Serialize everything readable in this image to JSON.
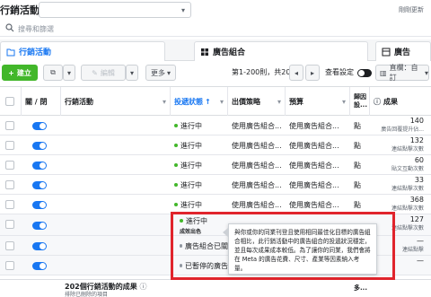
{
  "header": {
    "title": "行銷活動",
    "account_value": "",
    "updated_label": "剛剛更新"
  },
  "search": {
    "placeholder": "搜尋和篩選"
  },
  "tabs": [
    {
      "label": "行銷活動"
    },
    {
      "label": "廣告組合"
    },
    {
      "label": "廣告"
    }
  ],
  "toolbar": {
    "create_label": "建立",
    "edit_label": "編輯",
    "more_label": "更多",
    "range_label": "第1-200則，共202則",
    "view_setting_label": "查看設定",
    "columns_label": "直欄：自訂"
  },
  "table": {
    "headers": {
      "onoff": "關 / 閉",
      "campaign": "行銷活動",
      "delivery": "投遞狀態",
      "bid": "出價策略",
      "budget": "預算",
      "attribution": "歸因設...",
      "results": "成果"
    },
    "rows": [
      {
        "delivery": "進行中",
        "bid": "使用廣告組合...",
        "budget": "使用廣告組合...",
        "attribution": "點",
        "result": "140",
        "result_unit": "廣告回覆提升佔..."
      },
      {
        "delivery": "進行中",
        "bid": "使用廣告組合...",
        "budget": "使用廣告組合...",
        "attribution": "點",
        "result": "132",
        "result_unit": "連結點擊次數"
      },
      {
        "delivery": "進行中",
        "bid": "使用廣告組合...",
        "budget": "使用廣告組合...",
        "attribution": "點",
        "result": "60",
        "result_unit": "貼文互動次數"
      },
      {
        "delivery": "進行中",
        "bid": "使用廣告組合...",
        "budget": "使用廣告組合...",
        "attribution": "點",
        "result": "33",
        "result_unit": "連結點擊次數"
      },
      {
        "delivery": "進行中",
        "bid": "使用廣告組合...",
        "budget": "使用廣告組合...",
        "attribution": "點",
        "result": "368",
        "result_unit": "連結點擊次數"
      },
      {
        "delivery": "進行中",
        "delivery_sub": "成效出色",
        "bid": "",
        "budget": "",
        "attribution": "",
        "result": "127",
        "result_unit": "連結點擊次數"
      },
      {
        "delivery": "廣告組合已關",
        "bid": "",
        "budget": "",
        "attribution": "",
        "result": "—",
        "result_unit": "連結點擊"
      },
      {
        "delivery": "已暫停的廣告",
        "bid": "",
        "budget": "",
        "attribution": "",
        "result": "—",
        "result_unit": ""
      }
    ]
  },
  "summary": {
    "title": "202個行銷活動的成果",
    "subtitle": "排除已刪除的項目",
    "attribution": "多..."
  },
  "tooltip": {
    "text": "與你或你的同業刊登且使用相同最佳化目標的廣告組合相比，此行銷活動中的廣告組合的投遞狀況穩定，並且每次成果成本較低。為了讓你的同業，我們會將在 Meta 的廣告花費、尺寸、產業等因素納入考量。"
  },
  "colors": {
    "accent": "#1877f2",
    "create_green": "#42b72a",
    "active_green": "#42b72a",
    "highlight_red": "#e0242c"
  }
}
